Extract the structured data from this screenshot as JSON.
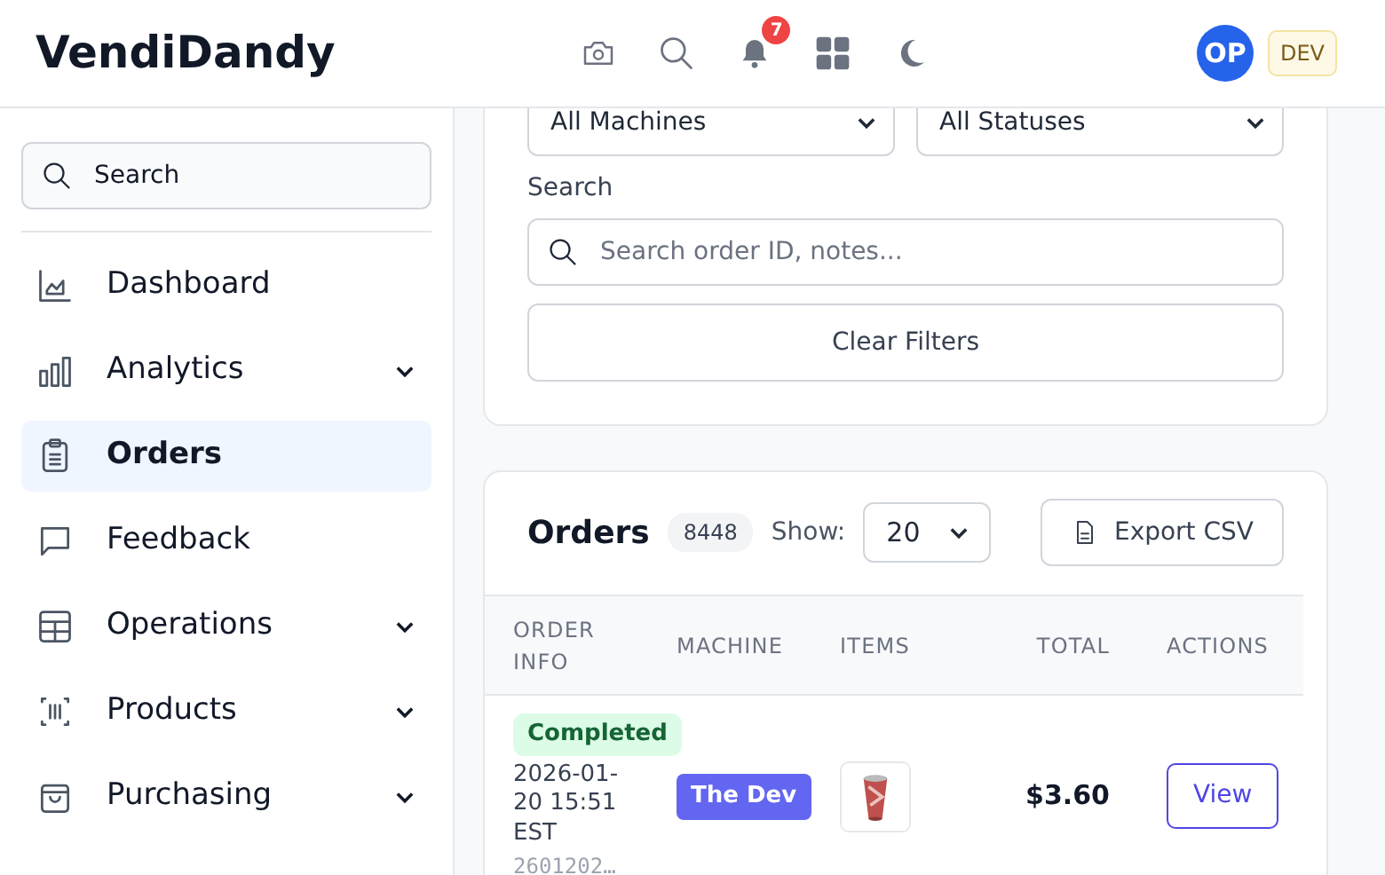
{
  "app": {
    "title": "VendiDandy",
    "notification_count": "7",
    "avatar_initials": "OP",
    "env_badge": "DEV"
  },
  "sidebar": {
    "search_placeholder": "Search",
    "items": [
      {
        "label": "Dashboard",
        "expandable": false,
        "selected": false
      },
      {
        "label": "Analytics",
        "expandable": true,
        "selected": false
      },
      {
        "label": "Orders",
        "expandable": false,
        "selected": true
      },
      {
        "label": "Feedback",
        "expandable": false,
        "selected": false
      },
      {
        "label": "Operations",
        "expandable": true,
        "selected": false
      },
      {
        "label": "Products",
        "expandable": true,
        "selected": false
      },
      {
        "label": "Purchasing",
        "expandable": true,
        "selected": false
      }
    ]
  },
  "filters": {
    "machine_select": "All Machines",
    "status_select": "All Statuses",
    "search_label": "Search",
    "search_placeholder": "Search order ID, notes...",
    "clear_button": "Clear Filters"
  },
  "orders": {
    "title": "Orders",
    "count": "8448",
    "show_label": "Show:",
    "page_size": "20",
    "export_button": "Export CSV",
    "columns": [
      "ORDER INFO",
      "MACHINE",
      "ITEMS",
      "TOTAL",
      "ACTIONS"
    ],
    "rows": [
      {
        "status": "Completed",
        "datetime": "2026-01-20 15:51 EST",
        "order_id": "2601202…",
        "machine": "The Dev",
        "total": "$3.60",
        "action": "View"
      }
    ]
  }
}
